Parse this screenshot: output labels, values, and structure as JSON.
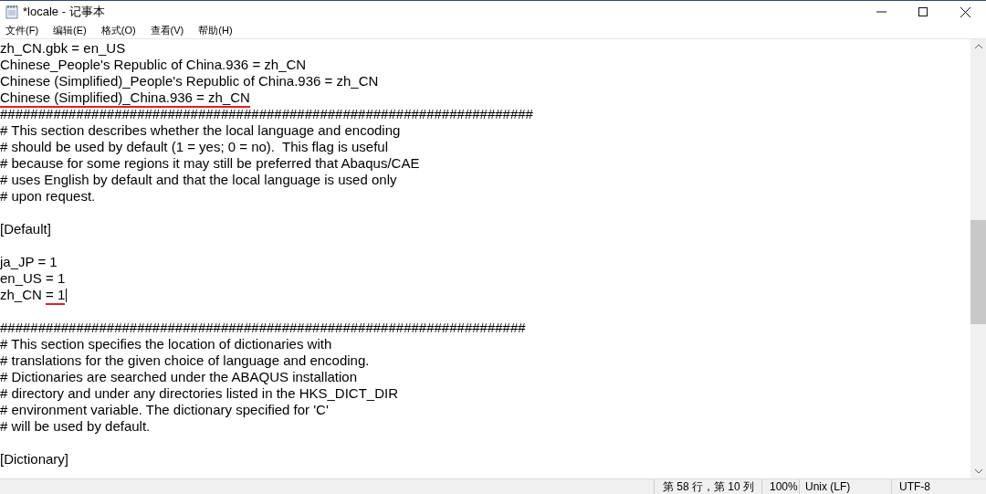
{
  "window": {
    "title": "*locale - 记事本"
  },
  "menu": [
    {
      "label": "文件(F)"
    },
    {
      "label": "编辑(E)"
    },
    {
      "label": "格式(O)"
    },
    {
      "label": "查看(V)"
    },
    {
      "label": "帮助(H)"
    }
  ],
  "editor": {
    "blocks": [
      {
        "lines": [
          {
            "parts": [
              {
                "text": "zh_CN.gbk = en_US",
                "underlined": false
              }
            ],
            "cursor": false
          },
          {
            "parts": [
              {
                "text": "Chinese_People's Republic of China.936 = zh_CN",
                "underlined": false
              }
            ],
            "cursor": false
          },
          {
            "parts": [
              {
                "text": "Chinese (Simplified)_People's Republic of China.936 = zh_CN",
                "underlined": false
              }
            ],
            "cursor": false
          },
          {
            "parts": [
              {
                "text": "Chinese (Simplified)_China.936 = zh_CN",
                "underlined": true
              }
            ],
            "cursor": false
          },
          {
            "parts": [
              {
                "text": "######################################################################",
                "underlined": false
              }
            ],
            "cursor": false
          },
          {
            "parts": [
              {
                "text": "# This section describes whether the local language and encoding",
                "underlined": false
              }
            ],
            "cursor": false
          },
          {
            "parts": [
              {
                "text": "# should be used by default (1 = yes; 0 = no).  This flag is useful",
                "underlined": false
              }
            ],
            "cursor": false
          },
          {
            "parts": [
              {
                "text": "# because for some regions it may still be preferred that Abaqus/CAE",
                "underlined": false
              }
            ],
            "cursor": false
          },
          {
            "parts": [
              {
                "text": "# uses English by default and that the local language is used only",
                "underlined": false
              }
            ],
            "cursor": false
          },
          {
            "parts": [
              {
                "text": "# upon request.",
                "underlined": false
              }
            ],
            "cursor": false
          }
        ]
      },
      {
        "lines": [
          {
            "parts": [
              {
                "text": "[Default]",
                "underlined": false
              }
            ],
            "cursor": false
          }
        ]
      },
      {
        "lines": [
          {
            "parts": [
              {
                "text": "ja_JP = 1",
                "underlined": false
              }
            ],
            "cursor": false
          },
          {
            "parts": [
              {
                "text": "en_US = 1",
                "underlined": false
              }
            ],
            "cursor": false
          },
          {
            "parts": [
              {
                "text": "zh_CN ",
                "underlined": false
              },
              {
                "text": "= 1",
                "underlined": true
              }
            ],
            "cursor": true
          }
        ]
      },
      {
        "lines": [
          {
            "parts": [
              {
                "text": "#####################################################################",
                "underlined": false
              }
            ],
            "cursor": false
          },
          {
            "parts": [
              {
                "text": "# This section specifies the location of dictionaries with",
                "underlined": false
              }
            ],
            "cursor": false
          },
          {
            "parts": [
              {
                "text": "# translations for the given choice of language and encoding.",
                "underlined": false
              }
            ],
            "cursor": false
          },
          {
            "parts": [
              {
                "text": "# Dictionaries are searched under the ABAQUS installation",
                "underlined": false
              }
            ],
            "cursor": false
          },
          {
            "parts": [
              {
                "text": "# directory and under any directories listed in the HKS_DICT_DIR",
                "underlined": false
              }
            ],
            "cursor": false
          },
          {
            "parts": [
              {
                "text": "# environment variable. The dictionary specified for 'C'",
                "underlined": false
              }
            ],
            "cursor": false
          },
          {
            "parts": [
              {
                "text": "# will be used by default.",
                "underlined": false
              }
            ],
            "cursor": false
          }
        ]
      },
      {
        "lines": [
          {
            "parts": [
              {
                "text": "[Dictionary]",
                "underlined": false
              }
            ],
            "cursor": false
          }
        ]
      }
    ]
  },
  "status_bar": {
    "position": "第 58 行，第 10 列",
    "zoom": "100%",
    "line_ending": "Unix (LF)",
    "encoding": "UTF-8"
  }
}
